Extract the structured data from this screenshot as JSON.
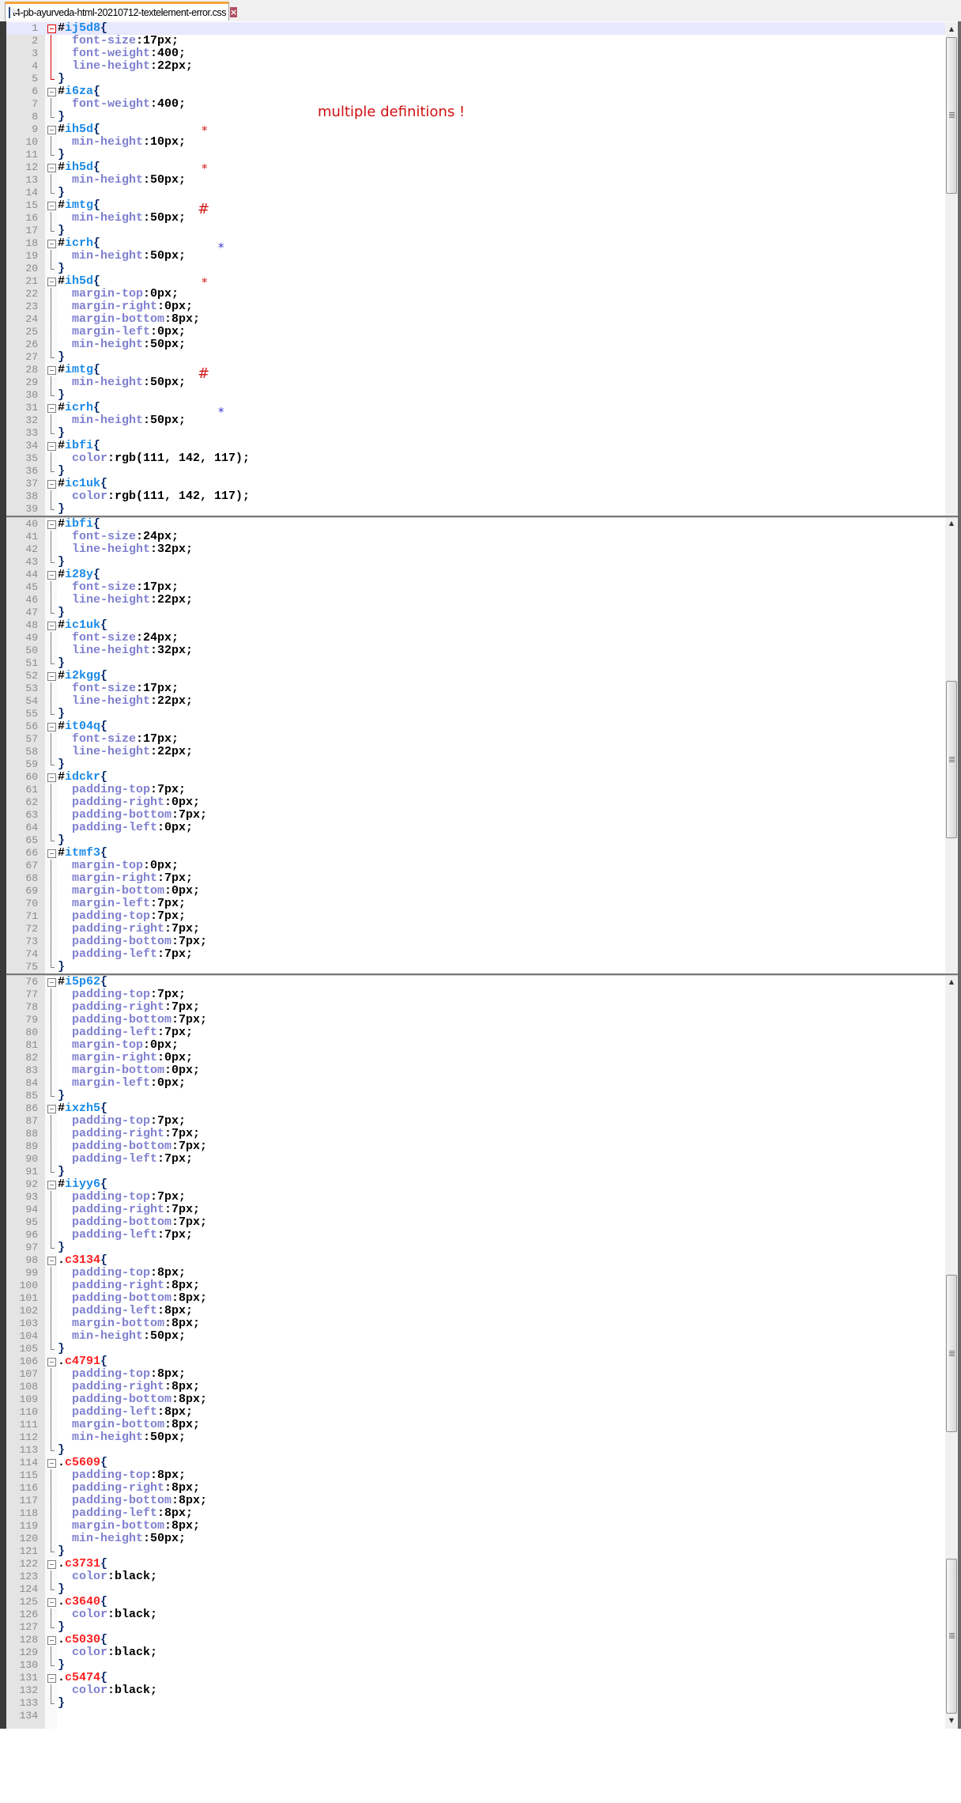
{
  "tab": {
    "title": "t4-pb-ayurveda-html-20210712-textelement-error.css",
    "close_icon": "close-icon",
    "file_icon": "css-file-icon"
  },
  "annotations": {
    "title": "multiple definitions !",
    "marks": [
      {
        "symbol": "*",
        "color": "#d01818",
        "line": 9
      },
      {
        "symbol": "*",
        "color": "#d01818",
        "line": 12
      },
      {
        "symbol": "#",
        "color": "#d01818",
        "line": 15
      },
      {
        "symbol": "*",
        "color": "#3a3ad8",
        "line": 18
      },
      {
        "symbol": "*",
        "color": "#d01818",
        "line": 21
      },
      {
        "symbol": "#",
        "color": "#d01818",
        "line": 28
      },
      {
        "symbol": "*",
        "color": "#3a3ad8",
        "line": 31
      }
    ]
  },
  "editor": {
    "current_line": 1,
    "panes": [
      {
        "first_line": 1,
        "lines": [
          "#ij5d8{",
          "  font-size:17px;",
          "  font-weight:400;",
          "  line-height:22px;",
          "}",
          "#i6za{",
          "  font-weight:400;",
          "}",
          "#ih5d{",
          "  min-height:10px;",
          "}",
          "#ih5d{",
          "  min-height:50px;",
          "}",
          "#imtg{",
          "  min-height:50px;",
          "}",
          "#icrh{",
          "  min-height:50px;",
          "}",
          "#ih5d{",
          "  margin-top:0px;",
          "  margin-right:0px;",
          "  margin-bottom:8px;",
          "  margin-left:0px;",
          "  min-height:50px;",
          "}",
          "#imtg{",
          "  min-height:50px;",
          "}",
          "#icrh{",
          "  min-height:50px;",
          "}",
          "#ibfi{",
          "  color:rgb(111, 142, 117);",
          "}",
          "#ic1uk{",
          "  color:rgb(111, 142, 117);",
          "}"
        ]
      },
      {
        "first_line": 40,
        "lines": [
          "#ibfi{",
          "  font-size:24px;",
          "  line-height:32px;",
          "}",
          "#i28y{",
          "  font-size:17px;",
          "  line-height:22px;",
          "}",
          "#ic1uk{",
          "  font-size:24px;",
          "  line-height:32px;",
          "}",
          "#i2kgg{",
          "  font-size:17px;",
          "  line-height:22px;",
          "}",
          "#it04q{",
          "  font-size:17px;",
          "  line-height:22px;",
          "}",
          "#idckr{",
          "  padding-top:7px;",
          "  padding-right:0px;",
          "  padding-bottom:7px;",
          "  padding-left:0px;",
          "}",
          "#itmf3{",
          "  margin-top:0px;",
          "  margin-right:7px;",
          "  margin-bottom:0px;",
          "  margin-left:7px;",
          "  padding-top:7px;",
          "  padding-right:7px;",
          "  padding-bottom:7px;",
          "  padding-left:7px;",
          "}"
        ]
      },
      {
        "first_line": 76,
        "lines": [
          "#i5p62{",
          "  padding-top:7px;",
          "  padding-right:7px;",
          "  padding-bottom:7px;",
          "  padding-left:7px;",
          "  margin-top:0px;",
          "  margin-right:0px;",
          "  margin-bottom:0px;",
          "  margin-left:0px;",
          "}",
          "#ixzh5{",
          "  padding-top:7px;",
          "  padding-right:7px;",
          "  padding-bottom:7px;",
          "  padding-left:7px;",
          "}",
          "#iiyy6{",
          "  padding-top:7px;",
          "  padding-right:7px;",
          "  padding-bottom:7px;",
          "  padding-left:7px;",
          "}",
          ".c3134{",
          "  padding-top:8px;",
          "  padding-right:8px;",
          "  padding-bottom:8px;",
          "  padding-left:8px;",
          "  margin-bottom:8px;",
          "  min-height:50px;",
          "}",
          ".c4791{",
          "  padding-top:8px;",
          "  padding-right:8px;",
          "  padding-bottom:8px;",
          "  padding-left:8px;",
          "  margin-bottom:8px;",
          "  min-height:50px;",
          "}",
          ".c5609{",
          "  padding-top:8px;",
          "  padding-right:8px;",
          "  padding-bottom:8px;",
          "  padding-left:8px;",
          "  margin-bottom:8px;",
          "  min-height:50px;",
          "}",
          ".c3731{",
          "  color:black;",
          "}",
          ".c3640{",
          "  color:black;",
          "}",
          ".c5030{",
          "  color:black;",
          "}",
          ".c5474{",
          "  color:black;",
          "}",
          ""
        ]
      }
    ]
  },
  "colors": {
    "selector_id": "#1a8ae8",
    "selector_class": "#ff2020",
    "property": "#8080d0",
    "value": "#000000",
    "tab_accent": "#f5a43a",
    "annotation_red": "#d01818",
    "annotation_blue": "#3a3ad8"
  }
}
